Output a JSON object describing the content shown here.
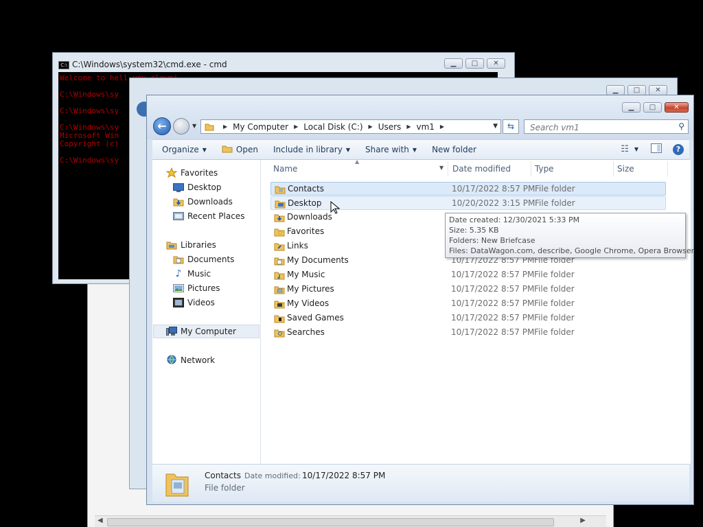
{
  "cmd": {
    "title": "C:\\Windows\\system32\\cmd.exe - cmd",
    "lines": [
      "Welcome to hell you clown!",
      "C:\\Windows\\sy",
      "C:\\Windows\\sy",
      "C:\\Windows\\sy",
      "Microsoft Win",
      "Copyright (c)",
      "C:\\Windows\\sy"
    ]
  },
  "explorer": {
    "address": {
      "crumbs": [
        "My Computer",
        "Local Disk (C:)",
        "Users",
        "vm1"
      ]
    },
    "search": {
      "placeholder": "Search vm1"
    },
    "toolbar": {
      "organize": "Organize",
      "open": "Open",
      "include": "Include in library",
      "share": "Share with",
      "new_folder": "New folder"
    },
    "nav": {
      "favorites": "Favorites",
      "favorites_items": [
        "Desktop",
        "Downloads",
        "Recent Places"
      ],
      "libraries": "Libraries",
      "libraries_items": [
        "Documents",
        "Music",
        "Pictures",
        "Videos"
      ],
      "computer": "My Computer",
      "network": "Network"
    },
    "columns": {
      "name": "Name",
      "date": "Date modified",
      "type": "Type",
      "size": "Size"
    },
    "rows": [
      {
        "name": "Contacts",
        "date": "10/17/2022 8:57 PM",
        "type": "File folder"
      },
      {
        "name": "Desktop",
        "date": "10/20/2022 3:15 PM",
        "type": "File folder"
      },
      {
        "name": "Downloads",
        "date": "",
        "type": ""
      },
      {
        "name": "Favorites",
        "date": "",
        "type": ""
      },
      {
        "name": "Links",
        "date": "",
        "type": ""
      },
      {
        "name": "My Documents",
        "date": "10/17/2022 8:57 PM",
        "type": "File folder"
      },
      {
        "name": "My Music",
        "date": "10/17/2022 8:57 PM",
        "type": "File folder"
      },
      {
        "name": "My Pictures",
        "date": "10/17/2022 8:57 PM",
        "type": "File folder"
      },
      {
        "name": "My Videos",
        "date": "10/17/2022 8:57 PM",
        "type": "File folder"
      },
      {
        "name": "Saved Games",
        "date": "10/17/2022 8:57 PM",
        "type": "File folder"
      },
      {
        "name": "Searches",
        "date": "10/17/2022 8:57 PM",
        "type": "File folder"
      }
    ],
    "tooltip": {
      "created": "Date created: 12/30/2021 5:33 PM",
      "size": "Size: 5.35 KB",
      "folders": "Folders: New Briefcase",
      "files": "Files: DataWagon.com, describe, Google Chrome, Opera Browser"
    },
    "details": {
      "name": "Contacts",
      "date_label": "Date modified:",
      "date_value": "10/17/2022 8:57 PM",
      "kind": "File folder"
    }
  },
  "colors": {
    "cmd_text": "#b30000",
    "selection": "#dce9f8",
    "hover": "#e8f1fb",
    "close_red": "#c6462f"
  }
}
